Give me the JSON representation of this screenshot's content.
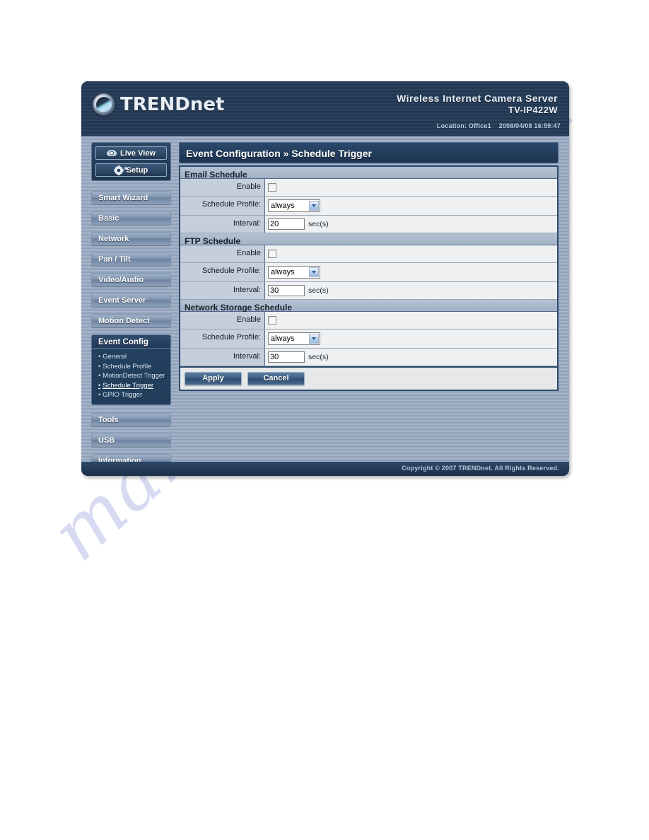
{
  "watermark": {
    "text": "manualshive.com"
  },
  "header": {
    "logo_text": "TRENDnet",
    "logo_icon": "globe-icon",
    "product_name": "Wireless Internet Camera Server",
    "model": "TV-IP422W",
    "status": "Location: Office1    2008/04/08 16:59:47"
  },
  "sidebar": {
    "primary": [
      {
        "label": "Live View",
        "icon": "eye-icon"
      },
      {
        "label": "Setup",
        "icon": "gear-icon"
      }
    ],
    "items": [
      {
        "label": "Smart Wizard",
        "active": false
      },
      {
        "label": "Basic",
        "active": false
      },
      {
        "label": "Network",
        "active": false
      },
      {
        "label": "Pan / Tilt",
        "active": false
      },
      {
        "label": "Video/Audio",
        "active": false
      },
      {
        "label": "Event Server",
        "active": false
      },
      {
        "label": "Motion Detect",
        "active": false
      },
      {
        "label": "Event Config",
        "active": true
      },
      {
        "label": "Tools",
        "active": false
      },
      {
        "label": "USB",
        "active": false
      },
      {
        "label": "Information",
        "active": false
      }
    ],
    "submenu": [
      {
        "label": "General",
        "current": false
      },
      {
        "label": "Schedule Profile",
        "current": false
      },
      {
        "label": "MotionDetect Trigger",
        "current": false
      },
      {
        "label": "Schedule Trigger",
        "current": true
      },
      {
        "label": "GPIO Trigger",
        "current": false
      }
    ]
  },
  "content": {
    "title": "Event Configuration » Schedule Trigger",
    "sections": [
      {
        "heading": "Email Schedule",
        "enable_label": "Enable",
        "enable_checked": false,
        "profile_label": "Schedule Profile:",
        "profile_value": "always",
        "interval_label": "Interval:",
        "interval_value": "20",
        "interval_unit": "sec(s)"
      },
      {
        "heading": "FTP Schedule",
        "enable_label": "Enable",
        "enable_checked": false,
        "profile_label": "Schedule Profile:",
        "profile_value": "always",
        "interval_label": "Interval:",
        "interval_value": "30",
        "interval_unit": "sec(s)"
      },
      {
        "heading": "Network Storage Schedule",
        "enable_label": "Enable",
        "enable_checked": false,
        "profile_label": "Schedule Profile:",
        "profile_value": "always",
        "interval_label": "Interval:",
        "interval_value": "30",
        "interval_unit": "sec(s)"
      }
    ],
    "buttons": {
      "apply": "Apply",
      "cancel": "Cancel"
    }
  },
  "footer": {
    "copyright": "Copyright © 2007 TRENDnet. All Rights Reserved."
  },
  "colors": {
    "header_dark": "#1d3049",
    "panel_blue": "#8f9fb8",
    "label_cell": "#c5cedc",
    "value_cell": "#eef0f1",
    "section_head": "#a3b2c6",
    "accent": "#2c4a6c"
  }
}
